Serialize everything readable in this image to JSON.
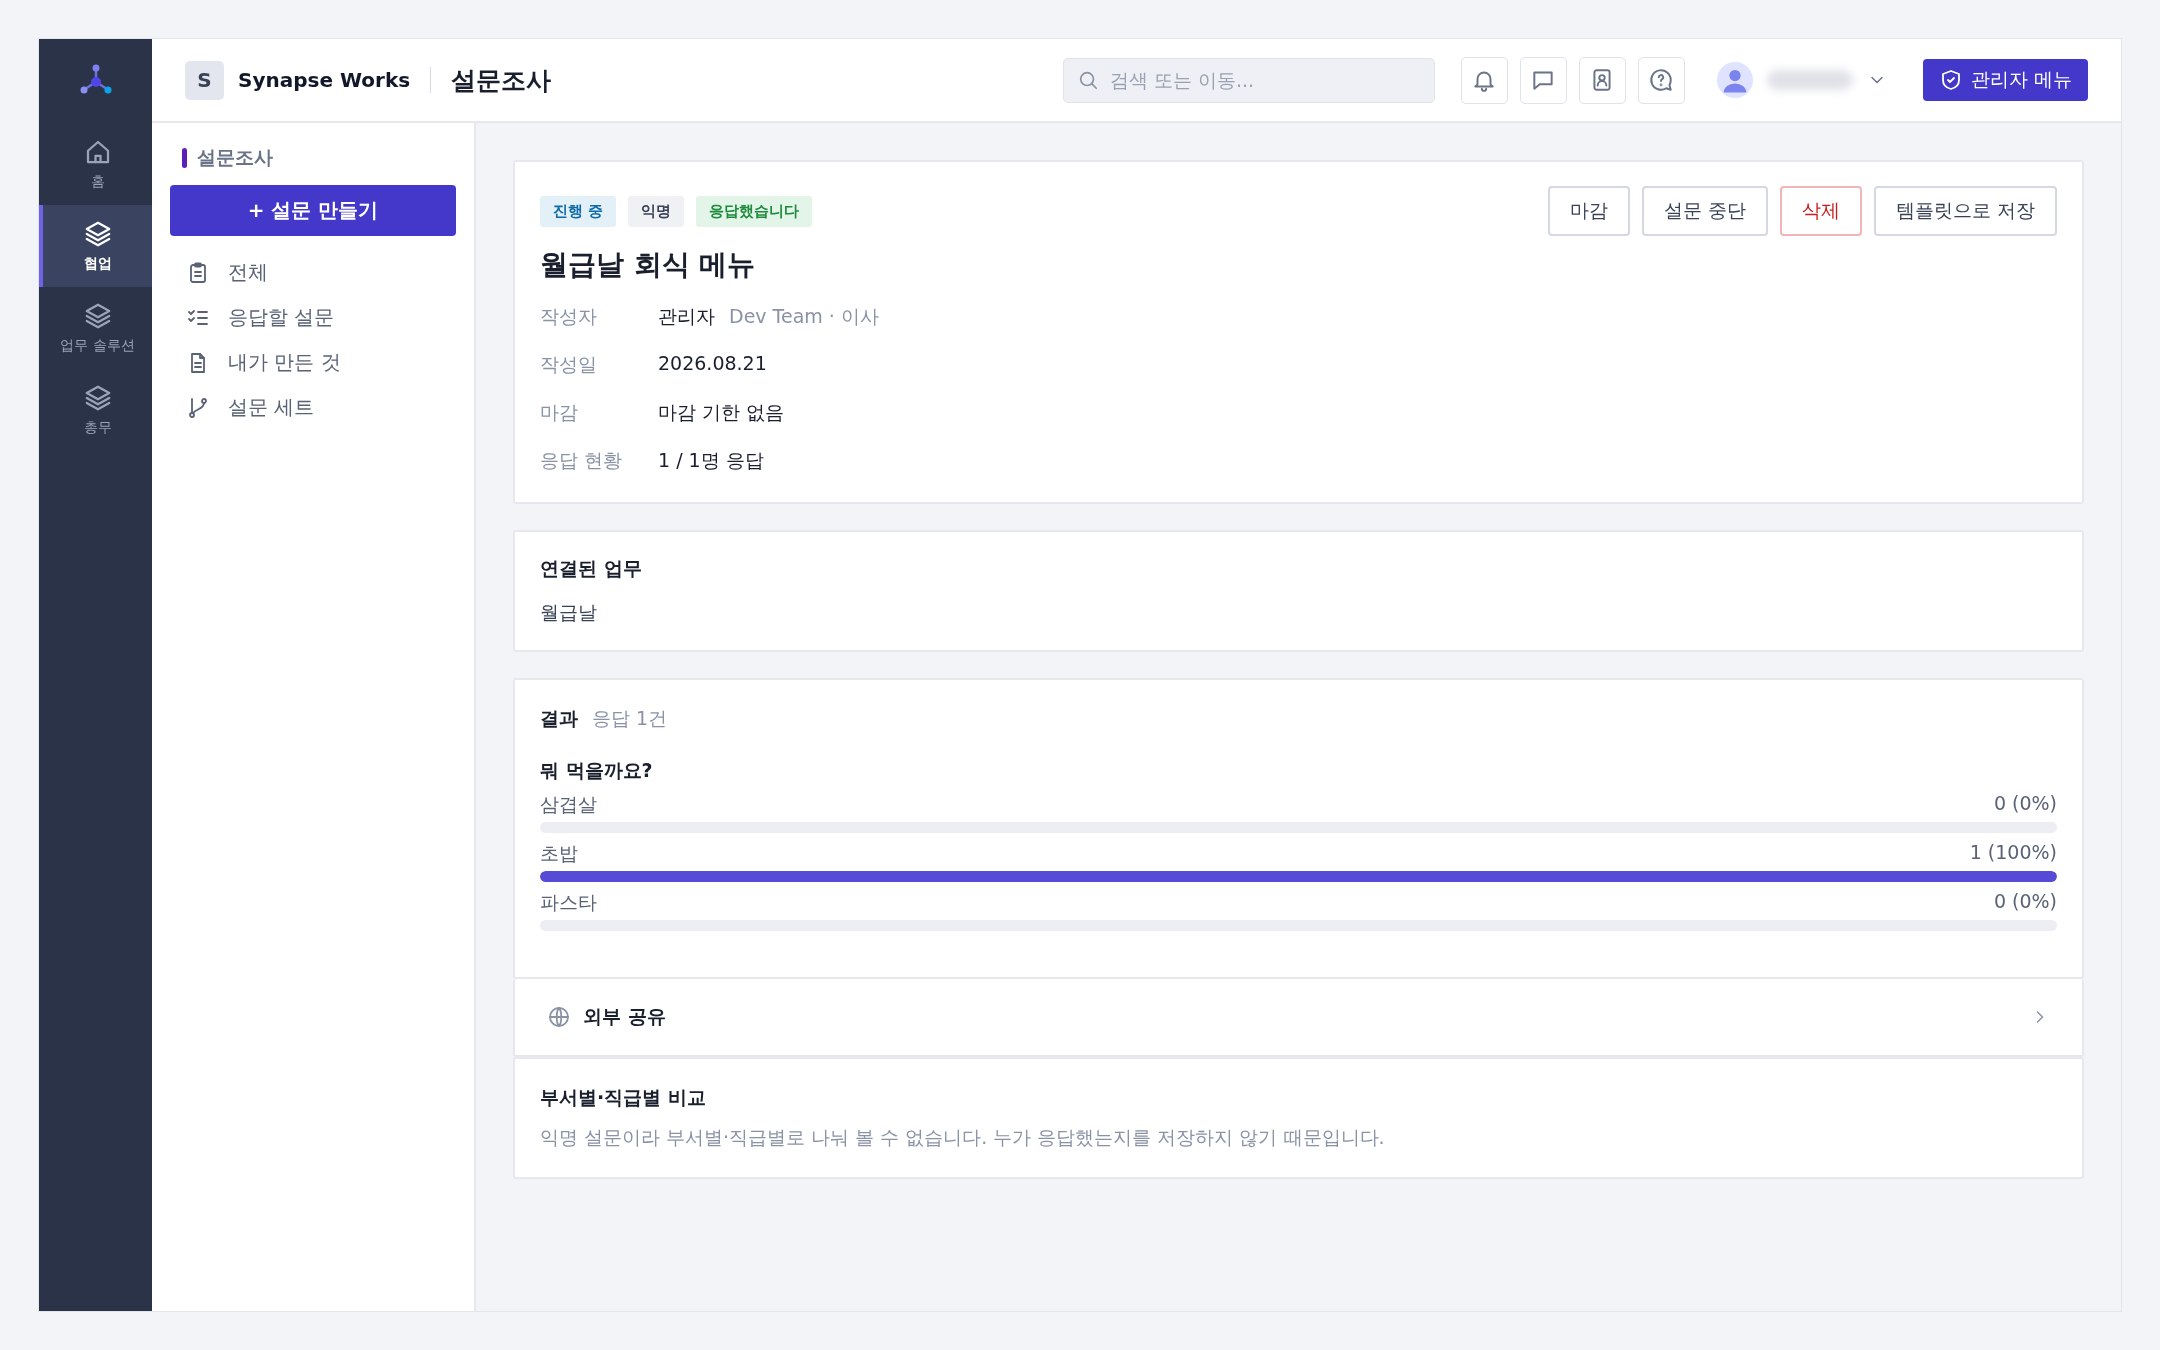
{
  "rail": {
    "items": [
      {
        "label": "홈",
        "kind": "home",
        "selected": false
      },
      {
        "label": "협업",
        "kind": "layers",
        "selected": true
      },
      {
        "label": "업무 솔루션",
        "kind": "layers",
        "selected": false
      },
      {
        "label": "총무",
        "kind": "layers",
        "selected": false
      }
    ]
  },
  "topbar": {
    "workspace_initial": "S",
    "workspace": "Synapse Works",
    "page_title": "설문조사",
    "search": {
      "placeholder": "검색 또는 이동..."
    },
    "icon_buttons": [
      {
        "kind": "bell"
      },
      {
        "kind": "chat"
      },
      {
        "kind": "contacts"
      },
      {
        "kind": "help"
      }
    ],
    "admin_button": "관리자 메뉴"
  },
  "sidebar": {
    "section_title": "설문조사",
    "create_button": "+ 설문 만들기",
    "items": [
      {
        "label": "전체",
        "kind": "clipboard"
      },
      {
        "label": "응답할 설문",
        "kind": "checklist"
      },
      {
        "label": "내가 만든 것",
        "kind": "document"
      },
      {
        "label": "설문 세트",
        "kind": "branch"
      }
    ]
  },
  "survey": {
    "badges": [
      {
        "label": "진행 중",
        "kind": "status"
      },
      {
        "label": "익명",
        "kind": "neutral"
      },
      {
        "label": "응답했습니다",
        "kind": "success"
      }
    ],
    "actions": [
      {
        "label": "마감",
        "kind": "default"
      },
      {
        "label": "설문 중단",
        "kind": "default"
      },
      {
        "label": "삭제",
        "kind": "danger"
      },
      {
        "label": "템플릿으로 저장",
        "kind": "default"
      }
    ],
    "title": "월급날 회식 메뉴",
    "meta": [
      {
        "label": "작성자",
        "value": "관리자",
        "note": "Dev Team · 이사"
      },
      {
        "label": "작성일",
        "value": "2026.08.21"
      },
      {
        "label": "마감",
        "value": "마감 기한 없음"
      },
      {
        "label": "응답 현황",
        "value": "1 / 1명 응답"
      }
    ]
  },
  "linked_task": {
    "title": "연결된 업무",
    "value": "월급날"
  },
  "results": {
    "title": "결과",
    "count": "응답 1건",
    "question": "뭐 먹을까요?",
    "options": [
      {
        "label": "삼겹살",
        "reading": "0 (0%)",
        "level": 0
      },
      {
        "label": "초밥",
        "reading": "1 (100%)",
        "level": 1
      },
      {
        "label": "파스타",
        "reading": "0 (0%)",
        "level": 0
      }
    ]
  },
  "external_share": {
    "label": "외부 공유"
  },
  "comparison": {
    "title": "부서별·직급별 비교",
    "note": "익명 설문이라 부서별·직급별로 나눠 볼 수 없습니다. 누가 응답했는지를 저장하지 않기 때문입니다."
  }
}
